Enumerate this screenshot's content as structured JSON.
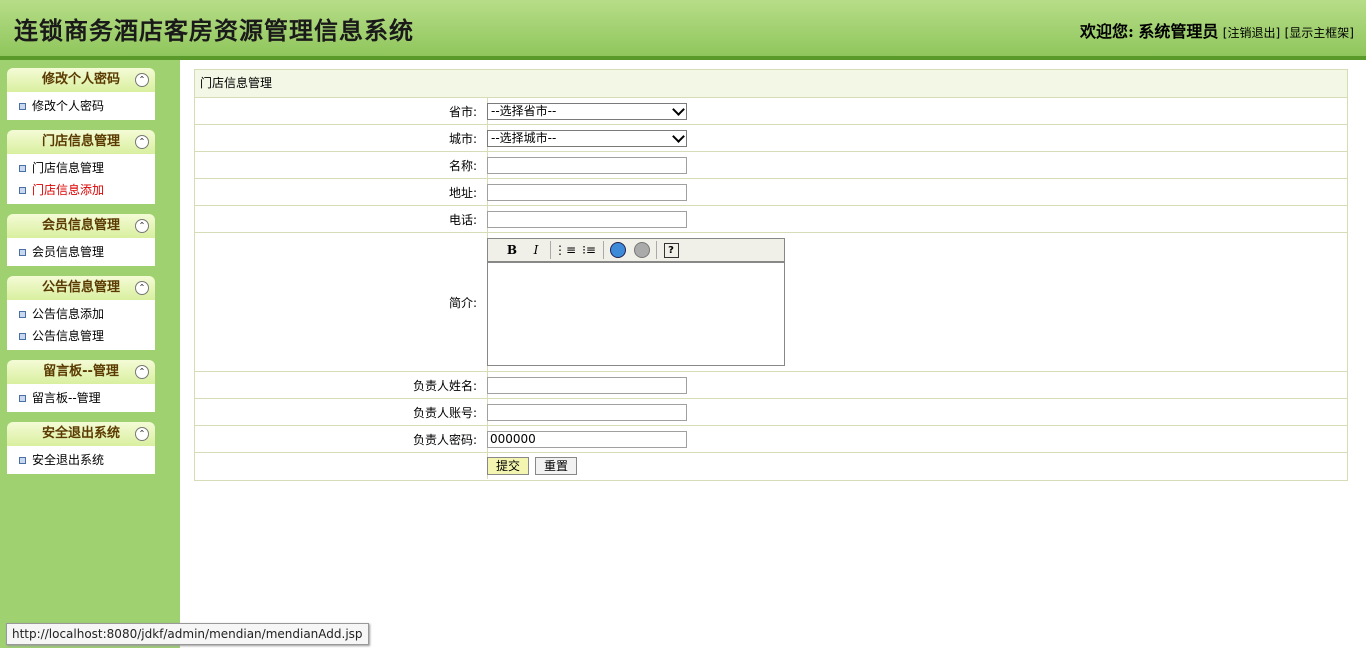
{
  "header": {
    "title": "连锁商务酒店客房资源管理信息系统",
    "welcome_label": "欢迎您:",
    "user": "系统管理员",
    "logout": "[注销退出]",
    "show_frame": "[显示主框架]"
  },
  "sidebar": {
    "groups": [
      {
        "title": "修改个人密码",
        "items": [
          "修改个人密码"
        ]
      },
      {
        "title": "门店信息管理",
        "items": [
          "门店信息管理",
          "门店信息添加"
        ]
      },
      {
        "title": "会员信息管理",
        "items": [
          "会员信息管理"
        ]
      },
      {
        "title": "公告信息管理",
        "items": [
          "公告信息添加",
          "公告信息管理"
        ]
      },
      {
        "title": "留言板--管理",
        "items": [
          "留言板--管理"
        ]
      },
      {
        "title": "安全退出系统",
        "items": [
          "安全退出系统"
        ]
      }
    ],
    "collapse_glyph": "⌃"
  },
  "panel": {
    "title": "门店信息管理",
    "fields": {
      "province_label": "省市:",
      "province_value": "--选择省市--",
      "city_label": "城市:",
      "city_value": "--选择城市--",
      "name_label": "名称:",
      "name_value": "",
      "address_label": "地址:",
      "address_value": "",
      "phone_label": "电话:",
      "phone_value": "",
      "intro_label": "简介:",
      "manager_name_label": "负责人姓名:",
      "manager_name_value": "",
      "manager_account_label": "负责人账号:",
      "manager_account_value": "",
      "manager_password_label": "负责人密码:",
      "manager_password_value": "000000"
    },
    "editor_toolbar": {
      "bold": "B",
      "italic": "I",
      "ordered_list": "⋮≡",
      "unordered_list": "⁝≡",
      "help": "?"
    },
    "submit_label": "提交",
    "reset_label": "重置"
  },
  "status_bar": {
    "url": "http://localhost:8080/jdkf/admin/mendian/mendianAdd.jsp"
  }
}
